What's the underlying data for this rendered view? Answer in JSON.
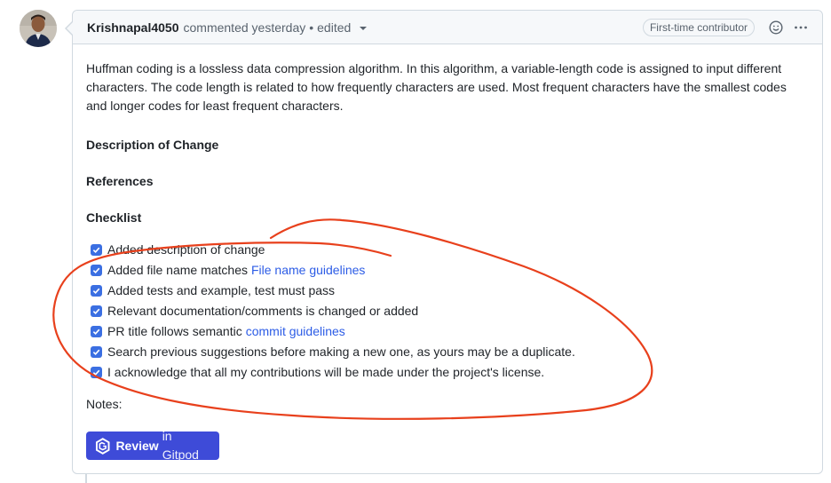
{
  "header": {
    "author": "Krishnapal4050",
    "action": "commented yesterday",
    "separator": "•",
    "edited_label": "edited",
    "badge": "First-time contributor",
    "icons": [
      "smiley-icon",
      "kebab-menu-icon"
    ]
  },
  "body": {
    "intro": "Huffman coding is a lossless data compression algorithm. In this algorithm, a variable-length code is assigned to input different characters. The code length is related to how frequently characters are used. Most frequent characters have the smallest codes and longer codes for least frequent characters.",
    "heading_description": "Description of Change",
    "heading_references": "References",
    "heading_checklist": "Checklist",
    "checklist": [
      {
        "text": "Added description of change",
        "link": "",
        "checked": true
      },
      {
        "text": "Added file name matches",
        "link": "File name guidelines",
        "checked": true
      },
      {
        "text": "Added tests and example, test must pass",
        "link": "",
        "checked": true
      },
      {
        "text": "Relevant documentation/comments is changed or added",
        "link": "",
        "checked": true
      },
      {
        "text": "PR title follows semantic",
        "link": "commit guidelines",
        "checked": true
      },
      {
        "text": "Search previous suggestions before making a new one, as yours may be a duplicate.",
        "link": "",
        "checked": true
      },
      {
        "text": "I acknowledge that all my contributions will be made under the project's license.",
        "link": "",
        "checked": true
      }
    ],
    "notes_label": "Notes:",
    "gitpod_button": {
      "bold": "Review",
      "rest": "in Gitpod"
    }
  },
  "colors": {
    "accent_checkbox": "#3b6fe2",
    "link": "#2c5ce6",
    "gitpod_button": "#3e4bd8",
    "annotation_stroke": "#e8401c"
  }
}
